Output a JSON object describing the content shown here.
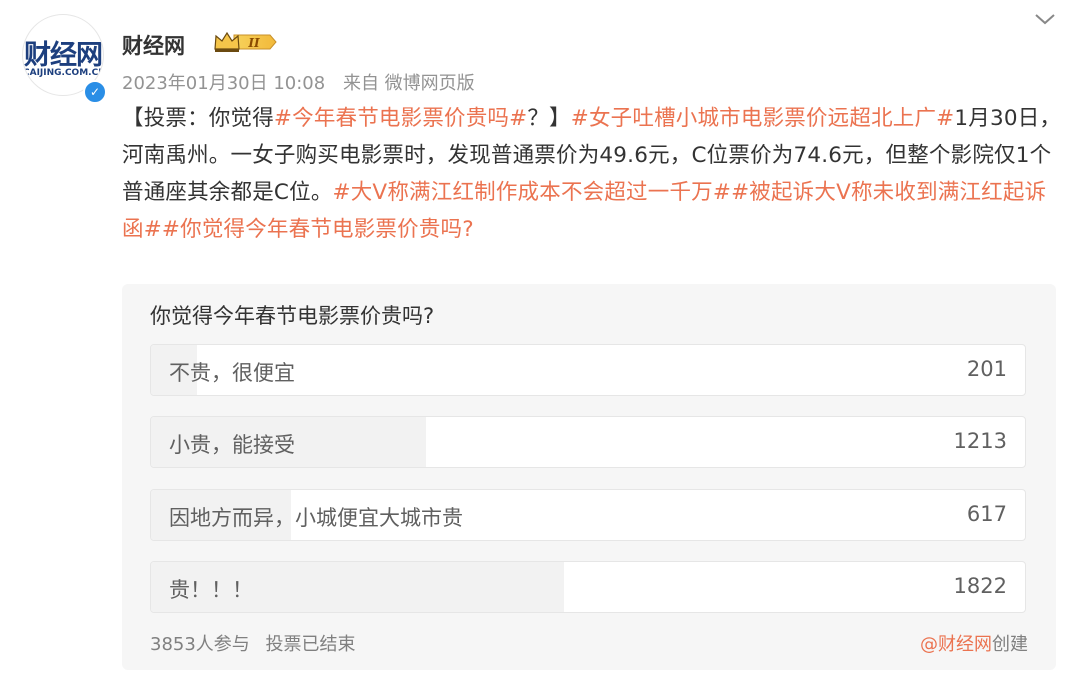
{
  "account": {
    "name": "财经网",
    "avatar_text": "财经网",
    "avatar_sub": "CAIJING.COM.CN",
    "vip_level": "II",
    "verified": true
  },
  "post": {
    "timestamp": "2023年01月30日 10:08",
    "source": "来自 微博网页版",
    "segments": [
      {
        "text": "【投票：你觉得",
        "hashtag": false
      },
      {
        "text": "#今年春节电影票价贵吗#",
        "hashtag": true
      },
      {
        "text": "？】",
        "hashtag": false
      },
      {
        "text": "#女子吐槽小城市电影票价远超北上广#",
        "hashtag": true
      },
      {
        "text": "1月30日，河南禹州。一女子购买电影票时，发现普通票价为49.6元，C位票价为74.6元，但整个影院仅1个普通座其余都是C位。",
        "hashtag": false
      },
      {
        "text": "#大V称满江红制作成本不会超过一千万#",
        "hashtag": true
      },
      {
        "text": "#被起诉大V称未收到满江红起诉函#",
        "hashtag": true
      },
      {
        "text": "#你觉得今年春节电影票价贵吗?",
        "hashtag": true
      }
    ]
  },
  "poll": {
    "question": "你觉得今年春节电影票价贵吗?",
    "total": 3853,
    "options": [
      {
        "label": "不贵，很便宜",
        "count": "201"
      },
      {
        "label": "小贵，能接受",
        "count": "1213"
      },
      {
        "label": "因地方而异，小城便宜大城市贵",
        "count": "617"
      },
      {
        "label": "贵！！！",
        "count": "1822"
      }
    ],
    "participants": "3853人参与",
    "status": "投票已结束",
    "creator": "@财经网",
    "creator_suffix": "创建"
  },
  "colors": {
    "hashtag": "#eb7350",
    "verified": "#2a8ee6",
    "brand_blue": "#1d3f7e"
  }
}
